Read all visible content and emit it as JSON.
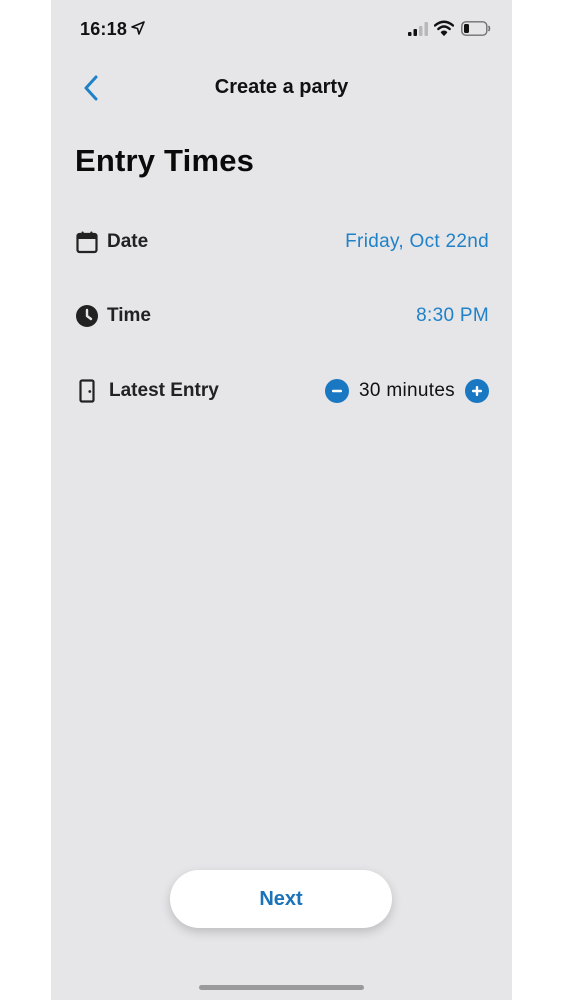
{
  "status_bar": {
    "time": "16:18",
    "icons": [
      "location-arrow-icon",
      "cellular-signal-icon",
      "wifi-icon",
      "battery-icon"
    ]
  },
  "nav": {
    "title": "Create a party",
    "back_icon": "chevron-left-icon"
  },
  "page": {
    "title": "Entry Times"
  },
  "rows": [
    {
      "icon": "calendar-icon",
      "label": "Date",
      "value": "Friday, Oct 22nd"
    },
    {
      "icon": "clock-icon",
      "label": "Time",
      "value": "8:30 PM"
    },
    {
      "icon": "door-icon",
      "label": "Latest Entry",
      "value": "30 minutes"
    }
  ],
  "footer": {
    "next_label": "Next"
  },
  "colors": {
    "background": "#e6e5e8",
    "accent": "#1f82c9",
    "stepper": "#1a78c2"
  }
}
